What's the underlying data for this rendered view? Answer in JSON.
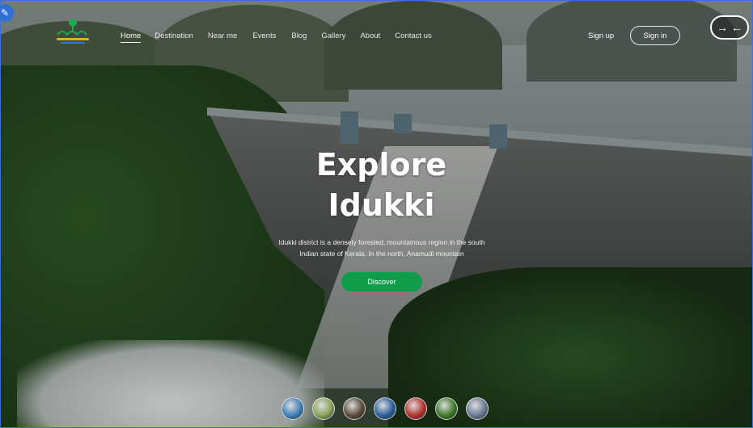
{
  "header": {
    "nav": [
      {
        "label": "Home",
        "active": true
      },
      {
        "label": "Destination"
      },
      {
        "label": "Near me"
      },
      {
        "label": "Events"
      },
      {
        "label": "Blog"
      },
      {
        "label": "Gallery"
      },
      {
        "label": "About"
      },
      {
        "label": "Contact us"
      }
    ],
    "signup_label": "Sign up",
    "signin_label": "Sign in",
    "toggle_icons": [
      "arrow-right-icon",
      "arrow-left-icon"
    ]
  },
  "hero": {
    "title_line1": "Explore",
    "title_line2": "Idukki",
    "description": "Idukki district is a densely forested, mountainous region in the south Indian state of Kerala. In the north, Anamudi mountain",
    "cta_label": "Discover"
  },
  "thumbnails": [
    {
      "name": "beach-thumb",
      "color": "#3e7fb8"
    },
    {
      "name": "tea-thumb",
      "color": "#8aa35a"
    },
    {
      "name": "temple-thumb",
      "color": "#5a4a3a"
    },
    {
      "name": "boat-thumb",
      "color": "#2b5d9a"
    },
    {
      "name": "art-thumb",
      "color": "#b3322e"
    },
    {
      "name": "forest-thumb",
      "color": "#3d7a2a"
    },
    {
      "name": "lake-thumb",
      "color": "#6a7a92"
    }
  ],
  "colors": {
    "accent": "#0f9d4a",
    "border": "#3b6fd8"
  }
}
